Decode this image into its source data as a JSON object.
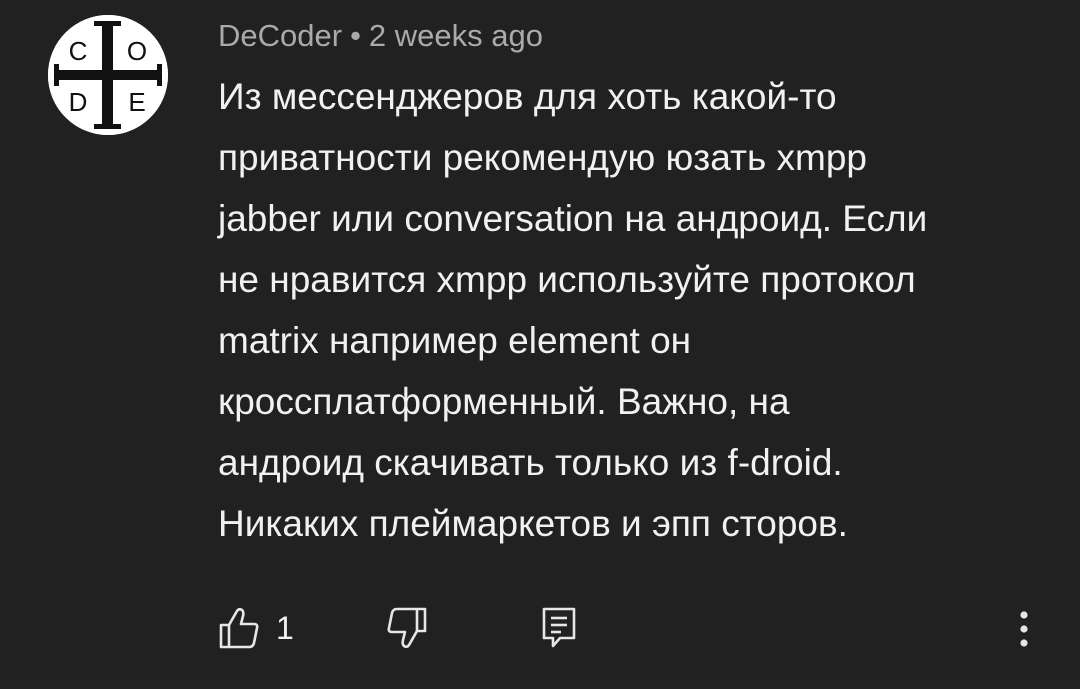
{
  "comment": {
    "author": "DeCoder",
    "separator": "•",
    "time": "2 weeks ago",
    "avatar_letters": [
      "C",
      "O",
      "D",
      "E"
    ],
    "text_lines": [
      "Из мессенджеров для хоть какой-то",
      "приватности рекомендую юзать xmpp",
      "jabber или conversation на андроид. Если",
      "не нравится xmpp используйте протокол",
      "matrix например element он",
      "кроссплатформенный. Важно, на",
      "андроид скачивать только из f-droid.",
      "Никаких плеймаркетов и эпп сторов."
    ],
    "like_count": "1"
  },
  "icons": {
    "like": "thumb-up-icon",
    "dislike": "thumb-down-icon",
    "reply": "comment-icon",
    "more": "more-vert-icon"
  },
  "colors": {
    "background": "#212121",
    "primary_text": "#f1f1f1",
    "secondary_text": "#aaaaaa"
  }
}
